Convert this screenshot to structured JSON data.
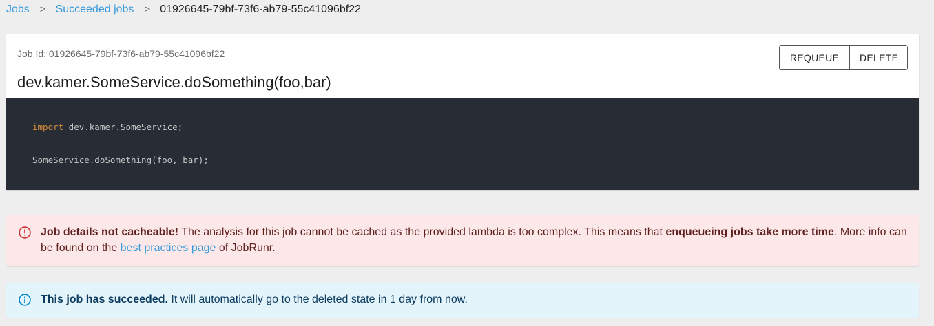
{
  "breadcrumb": {
    "jobs": "Jobs",
    "succeeded": "Succeeded jobs",
    "current": "01926645-79bf-73f6-ab79-55c41096bf22",
    "separator": ">"
  },
  "job": {
    "id_label": "Job Id: 01926645-79bf-73f6-ab79-55c41096bf22",
    "title": "dev.kamer.SomeService.doSomething(foo,bar)"
  },
  "actions": {
    "requeue": "REQUEUE",
    "delete": "DELETE"
  },
  "code": {
    "keyword": "import",
    "import_rest": " dev.kamer.SomeService;",
    "call": "SomeService.doSomething(foo, bar);"
  },
  "warning": {
    "bold1": "Job details not cacheable!",
    "text1": " The analysis for this job cannot be cached as the provided lambda is too complex. This means that ",
    "bold2": "enqueueing jobs take more time",
    "text2": ". More info can be found on the ",
    "link": "best practices page",
    "text3": " of JobRunr."
  },
  "info": {
    "bold": "This job has succeeded.",
    "text": " It will automatically go to the deleted state in 1 day from now."
  },
  "colors": {
    "link": "#3a9ad9",
    "code_bg": "#282c34",
    "warning_bg": "#fce8e8",
    "info_bg": "#e4f4fb"
  },
  "icons": {
    "warning": "error-outline-icon",
    "info": "info-outline-icon"
  }
}
